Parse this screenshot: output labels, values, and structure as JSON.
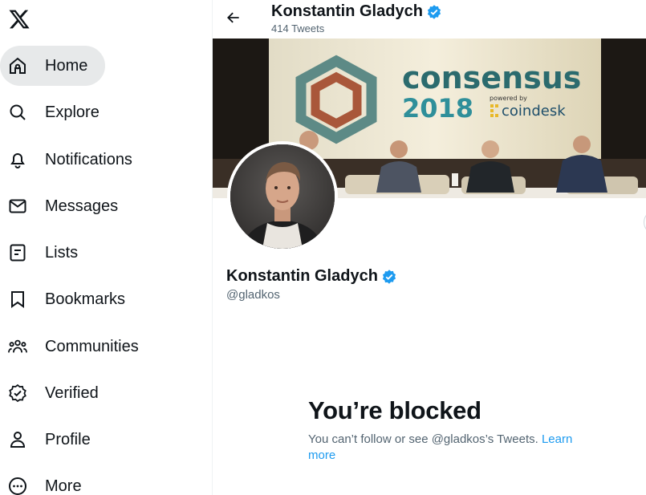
{
  "sidebar": {
    "logo_icon": "x-logo-icon",
    "items": [
      {
        "label": "Home",
        "icon": "home-icon"
      },
      {
        "label": "Explore",
        "icon": "search-icon"
      },
      {
        "label": "Notifications",
        "icon": "bell-icon"
      },
      {
        "label": "Messages",
        "icon": "envelope-icon"
      },
      {
        "label": "Lists",
        "icon": "list-icon"
      },
      {
        "label": "Bookmarks",
        "icon": "bookmark-icon"
      },
      {
        "label": "Communities",
        "icon": "people-icon"
      },
      {
        "label": "Verified",
        "icon": "verified-icon"
      },
      {
        "label": "Profile",
        "icon": "person-icon"
      },
      {
        "label": "More",
        "icon": "more-circle-icon"
      }
    ]
  },
  "header": {
    "name": "Konstantin Gladych",
    "tweet_count": "414 Tweets"
  },
  "banner": {
    "event_word": "consensus",
    "event_year": "2018",
    "powered_by": "powered by",
    "sponsor": "coindesk"
  },
  "profile": {
    "name": "Konstantin Gladych",
    "handle": "@gladkos"
  },
  "blocked": {
    "title": "You’re blocked",
    "text": "You can’t follow or see @gladkos’s Tweets.",
    "link_text": "Learn more"
  },
  "colors": {
    "accent": "#1d9bf0",
    "text_primary": "#0f1419",
    "text_secondary": "#536471",
    "active_bg": "#e7e9ea"
  }
}
